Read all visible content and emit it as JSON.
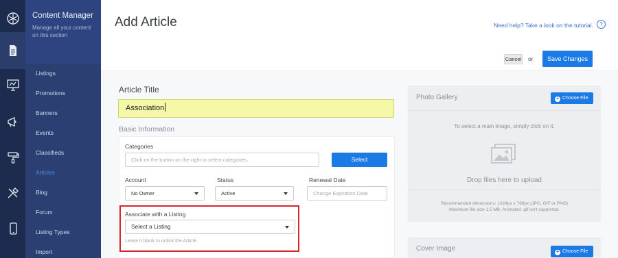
{
  "rail": {
    "icons": [
      "dashboard-icon",
      "content-icon",
      "site-icon",
      "marketing-icon",
      "design-icon",
      "tools-icon",
      "mobile-icon"
    ]
  },
  "sidebar": {
    "title": "Content Manager",
    "description": "Manage all your content on this section",
    "items": [
      {
        "label": "Listings"
      },
      {
        "label": "Promotions"
      },
      {
        "label": "Banners"
      },
      {
        "label": "Events"
      },
      {
        "label": "Classifieds"
      },
      {
        "label": "Articles",
        "active": true
      },
      {
        "label": "Blog"
      },
      {
        "label": "Forum"
      },
      {
        "label": "Listing Types"
      },
      {
        "label": "Import"
      }
    ]
  },
  "header": {
    "title": "Add Article",
    "help_text": "Need help? Take a look on the tutorial.",
    "help_icon": "?",
    "cancel_label": "Cancel",
    "or_label": "or",
    "save_label": "Save Changes"
  },
  "form": {
    "article_title_label": "Article Title",
    "article_title_value": "Association",
    "basic_info_label": "Basic Information",
    "categories_label": "Categories",
    "categories_placeholder": "Click on the button on the right to select categories.",
    "select_button": "Select",
    "account_label": "Account",
    "account_value": "No Owner",
    "status_label": "Status",
    "status_value": "Active",
    "renewal_label": "Renewal Date",
    "renewal_placeholder": "Change Expiration Date",
    "associate_label": "Associate with a Listing",
    "associate_value": "Select a Listing",
    "associate_hint": "Leave it blank to unlink the Article."
  },
  "photo_gallery": {
    "title": "Photo Gallery",
    "choose_file": "Choose File",
    "hint": "To select a main image, simply click on it.",
    "drop_text": "Drop files here to upload",
    "recommended": "Recommended dimensions: 1024px x 768px (JPG, GIF or PNG)",
    "max_size": "Maximum file size 1.5 MB. Animated .gif isn't supported."
  },
  "cover_image": {
    "title": "Cover Image",
    "choose_file": "Choose File"
  },
  "colors": {
    "rail": "#1d2b4f",
    "sidebar": "#2b3f72",
    "accent": "#1b7ae3",
    "highlight_input": "#f5f8a6",
    "annotation_red": "#d9262e"
  }
}
